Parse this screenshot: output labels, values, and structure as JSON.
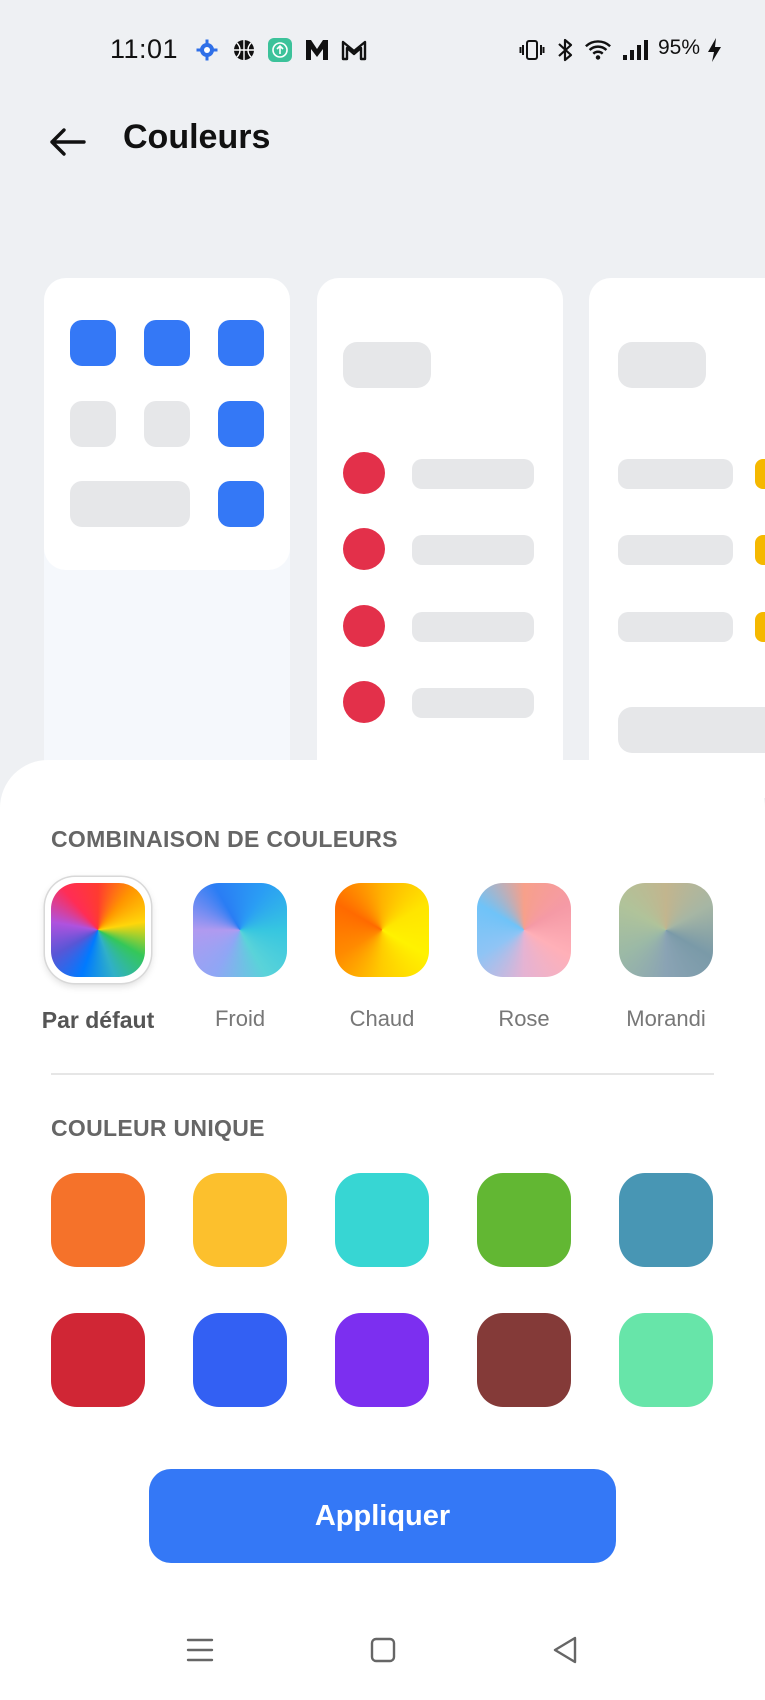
{
  "status_bar": {
    "time": "11:01",
    "battery": "95%",
    "left_icons": [
      "gear-icon",
      "basketball-icon",
      "upload-app-icon",
      "m-app-icon",
      "gmail-icon"
    ],
    "right_icons": [
      "vibrate-icon",
      "bluetooth-icon",
      "wifi-icon",
      "signal-icon",
      "charging-icon"
    ]
  },
  "header": {
    "title": "Couleurs",
    "back_icon": "arrow-left-icon"
  },
  "preview": {
    "accent_blue": "#3478f6",
    "accent_red": "#e3304a",
    "accent_yellow": "#f5b800"
  },
  "combinations": {
    "title": "COMBINAISON DE COULEURS",
    "items": [
      {
        "label": "Par défaut",
        "selected": true
      },
      {
        "label": "Froid",
        "selected": false
      },
      {
        "label": "Chaud",
        "selected": false
      },
      {
        "label": "Rose",
        "selected": false
      },
      {
        "label": "Morandi",
        "selected": false
      }
    ]
  },
  "single_color": {
    "title": "COULEUR UNIQUE",
    "colors": [
      "#f5722a",
      "#fcc02d",
      "#37d6d3",
      "#62b733",
      "#4896b4",
      "#d02635",
      "#3360f3",
      "#7c2ff0",
      "#843a38",
      "#67e5a9"
    ]
  },
  "apply_button": {
    "label": "Appliquer",
    "color": "#3478f6"
  },
  "nav_bar": {
    "icons": [
      "menu-icon",
      "home-square-icon",
      "back-triangle-icon"
    ]
  }
}
